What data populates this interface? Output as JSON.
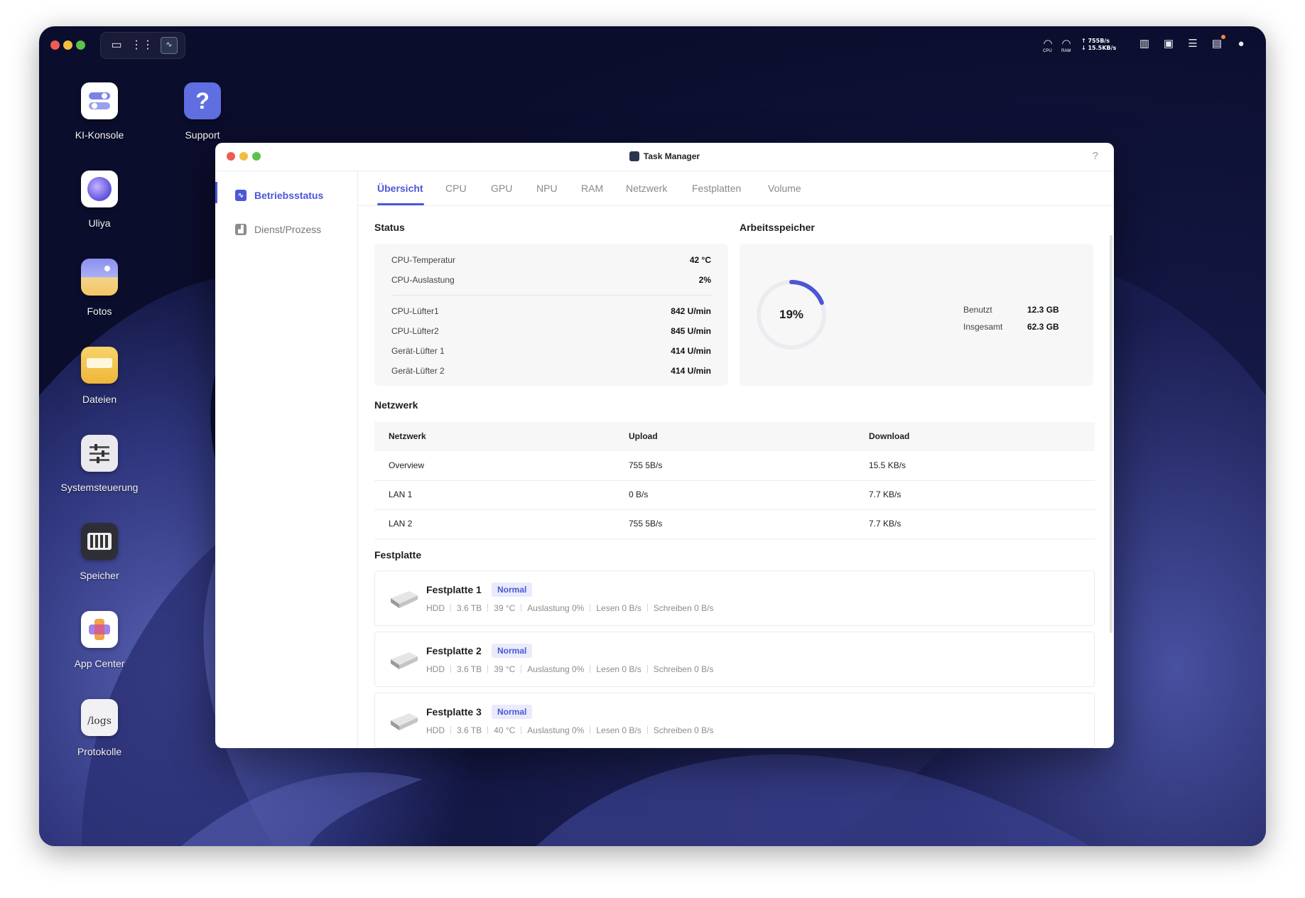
{
  "topbar": {
    "net_up": "↑ 755B/s",
    "net_down": "↓ 15.5KB/s",
    "cpu_label": "CPU",
    "ram_label": "RAM"
  },
  "desktop_icons": [
    {
      "label": "KI-Konsole",
      "icon": "toggles-icon"
    },
    {
      "label": "Support",
      "icon": "question-icon"
    },
    {
      "label": "Uliya",
      "icon": "orb-icon"
    },
    {
      "label": "Fotos",
      "icon": "photo-icon"
    },
    {
      "label": "Dateien",
      "icon": "folder-icon"
    },
    {
      "label": "Systemsteuerung",
      "icon": "sliders-icon"
    },
    {
      "label": "Speicher",
      "icon": "drive-bays-icon"
    },
    {
      "label": "App Center",
      "icon": "app-center-icon"
    },
    {
      "label": "Protokolle",
      "icon": "logs-icon",
      "icon_text": "/logs"
    }
  ],
  "window": {
    "title": "Task Manager",
    "help": "?"
  },
  "sidebar": {
    "items": [
      {
        "label": "Betriebsstatus",
        "active": true
      },
      {
        "label": "Dienst/Prozess",
        "active": false
      }
    ]
  },
  "tabs": [
    "Übersicht",
    "CPU",
    "GPU",
    "NPU",
    "RAM",
    "Netzwerk",
    "Festplatten",
    "Volume"
  ],
  "status": {
    "title": "Status",
    "rows_top": [
      {
        "label": "CPU-Temperatur",
        "value": "42 °C"
      },
      {
        "label": "CPU-Auslastung",
        "value": "2%"
      }
    ],
    "rows_fans": [
      {
        "label": "CPU-Lüfter1",
        "value": "842 U/min"
      },
      {
        "label": "CPU-Lüfter2",
        "value": "845 U/min"
      },
      {
        "label": "Gerät-Lüfter 1",
        "value": "414 U/min"
      },
      {
        "label": "Gerät-Lüfter 2",
        "value": "414 U/min"
      }
    ]
  },
  "memory": {
    "title": "Arbeitsspeicher",
    "percent_label": "19%",
    "percent": 19,
    "used_label": "Benutzt",
    "used_value": "12.3 GB",
    "total_label": "Insgesamt",
    "total_value": "62.3 GB",
    "accent": "#4b57d6"
  },
  "network": {
    "title": "Netzwerk",
    "headers": [
      "Netzwerk",
      "Upload",
      "Download"
    ],
    "rows": [
      [
        "Overview",
        "755 5B/s",
        "15.5 KB/s"
      ],
      [
        "LAN 1",
        "0 B/s",
        "7.7 KB/s"
      ],
      [
        "LAN 2",
        "755 5B/s",
        "7.7 KB/s"
      ]
    ]
  },
  "disks": {
    "title": "Festplatte",
    "items": [
      {
        "name": "Festplatte 1",
        "status": "Normal",
        "type": "HDD",
        "size": "3.6 TB",
        "temp": "39 °C",
        "load": "Auslastung 0%",
        "read": "Lesen 0 B/s",
        "write": "Schreiben 0 B/s"
      },
      {
        "name": "Festplatte 2",
        "status": "Normal",
        "type": "HDD",
        "size": "3.6 TB",
        "temp": "39 °C",
        "load": "Auslastung 0%",
        "read": "Lesen 0 B/s",
        "write": "Schreiben 0 B/s"
      },
      {
        "name": "Festplatte 3",
        "status": "Normal",
        "type": "HDD",
        "size": "3.6 TB",
        "temp": "40 °C",
        "load": "Auslastung 0%",
        "read": "Lesen 0 B/s",
        "write": "Schreiben 0 B/s"
      }
    ]
  }
}
